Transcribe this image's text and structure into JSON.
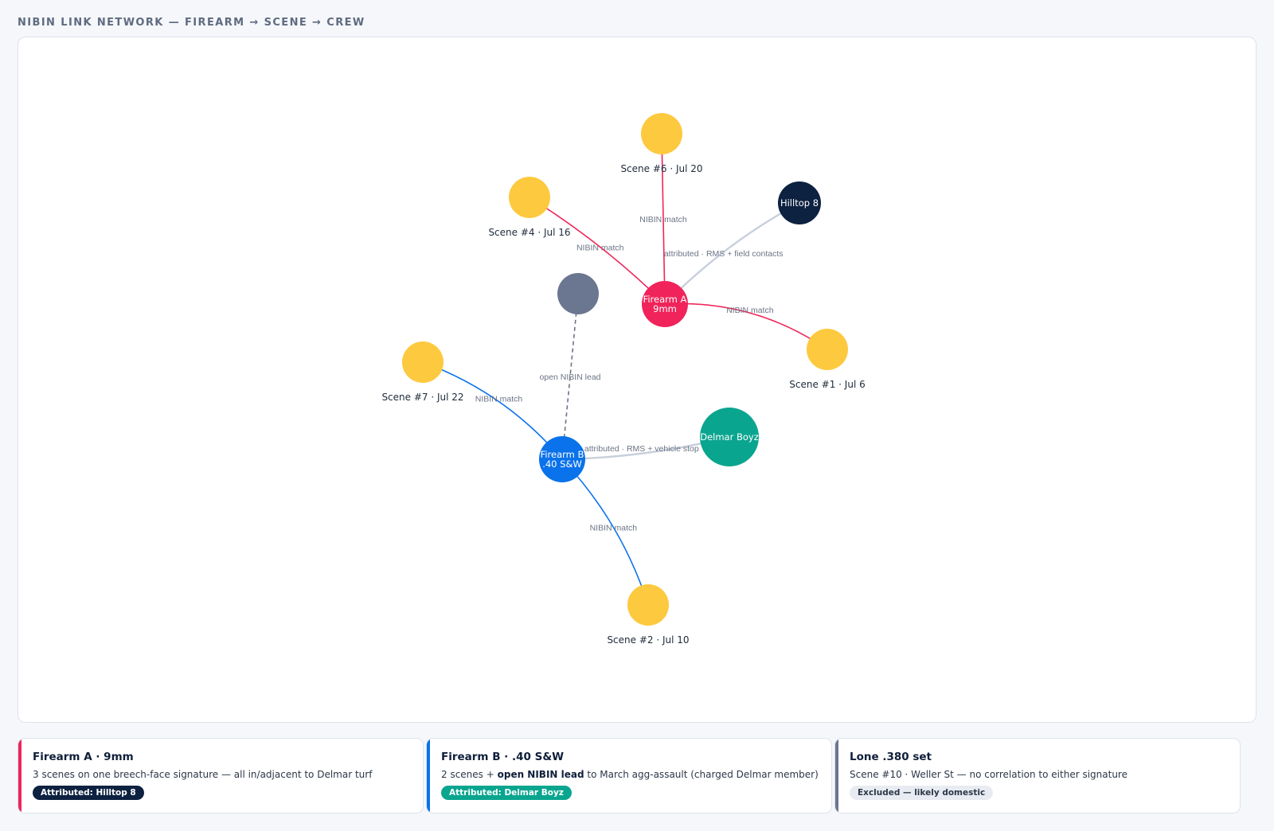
{
  "header": {
    "title": "NIBIN LINK NETWORK — FIREARM → SCENE → CREW"
  },
  "colors": {
    "scene": "#fdc93f",
    "firearm_a": "#f0245a",
    "firearm_b": "#0a72ea",
    "hilltop": "#0d2140",
    "delmar": "#0aa58f",
    "unknown": "#6b7690",
    "attribution_edge": "#c7cfdc",
    "lead_edge": "#6b7485"
  },
  "graph": {
    "nodes": [
      {
        "id": "scene6",
        "kind": "scene",
        "inner": "",
        "label": "Scene #6 · Jul 20"
      },
      {
        "id": "scene4",
        "kind": "scene",
        "inner": "",
        "label": "Scene #4 · Jul 16"
      },
      {
        "id": "hilltop",
        "kind": "hilltop",
        "inner": "Hilltop 8",
        "label": ""
      },
      {
        "id": "firearmA",
        "kind": "firearm_a",
        "inner": "Firearm A\n9mm",
        "label": ""
      },
      {
        "id": "unknown",
        "kind": "unknown",
        "inner": "",
        "label": ""
      },
      {
        "id": "scene1",
        "kind": "scene",
        "inner": "",
        "label": "Scene #1 · Jul 6"
      },
      {
        "id": "scene7",
        "kind": "scene",
        "inner": "",
        "label": "Scene #7 · Jul 22"
      },
      {
        "id": "delmar",
        "kind": "delmar",
        "inner": "Delmar Boyz",
        "label": ""
      },
      {
        "id": "firearmB",
        "kind": "firearm_b",
        "inner": "Firearm B\n.40 S&W",
        "label": ""
      },
      {
        "id": "scene2",
        "kind": "scene",
        "inner": "",
        "label": "Scene #2 · Jul 10"
      }
    ],
    "edges": [
      {
        "from": "firearmA",
        "to": "scene6",
        "kind": "nibin",
        "label": "NIBIN match"
      },
      {
        "from": "firearmA",
        "to": "scene4",
        "kind": "nibin",
        "label": "NIBIN match"
      },
      {
        "from": "firearmA",
        "to": "scene1",
        "kind": "nibin",
        "label": "NIBIN match"
      },
      {
        "from": "firearmA",
        "to": "hilltop",
        "kind": "attributed",
        "label": "attributed · RMS + field contacts"
      },
      {
        "from": "firearmB",
        "to": "scene7",
        "kind": "nibin",
        "label": "NIBIN match"
      },
      {
        "from": "firearmB",
        "to": "scene2",
        "kind": "nibin",
        "label": "NIBIN match"
      },
      {
        "from": "firearmB",
        "to": "delmar",
        "kind": "attributed",
        "label": "attributed · RMS + vehicle stop"
      },
      {
        "from": "firearmB",
        "to": "unknown",
        "kind": "lead",
        "label": "open NIBIN lead"
      }
    ]
  },
  "cards": [
    {
      "title": "Firearm A · 9mm",
      "desc_plain": "3 scenes on one breech-face signature — all in/adjacent to Delmar turf",
      "badge": "Attributed: Hilltop 8",
      "accent": "#f0245a",
      "badge_bg": "#0d2140",
      "badge_fg": "#ffffff"
    },
    {
      "title": "Firearm B · .40 S&W",
      "desc_pre": "2 scenes + ",
      "desc_strong": "open NIBIN lead",
      "desc_post": " to March agg-assault (charged Delmar member)",
      "badge": "Attributed: Delmar Boyz",
      "accent": "#0a72ea",
      "badge_bg": "#0aa58f",
      "badge_fg": "#ffffff"
    },
    {
      "title": "Lone .380 set",
      "desc_plain": "Scene #10 · Weller St — no correlation to either signature",
      "badge": "Excluded — likely domestic",
      "accent": "#6b7690",
      "badge_bg": "#e8ecf2",
      "badge_fg": "#2c3748"
    }
  ]
}
